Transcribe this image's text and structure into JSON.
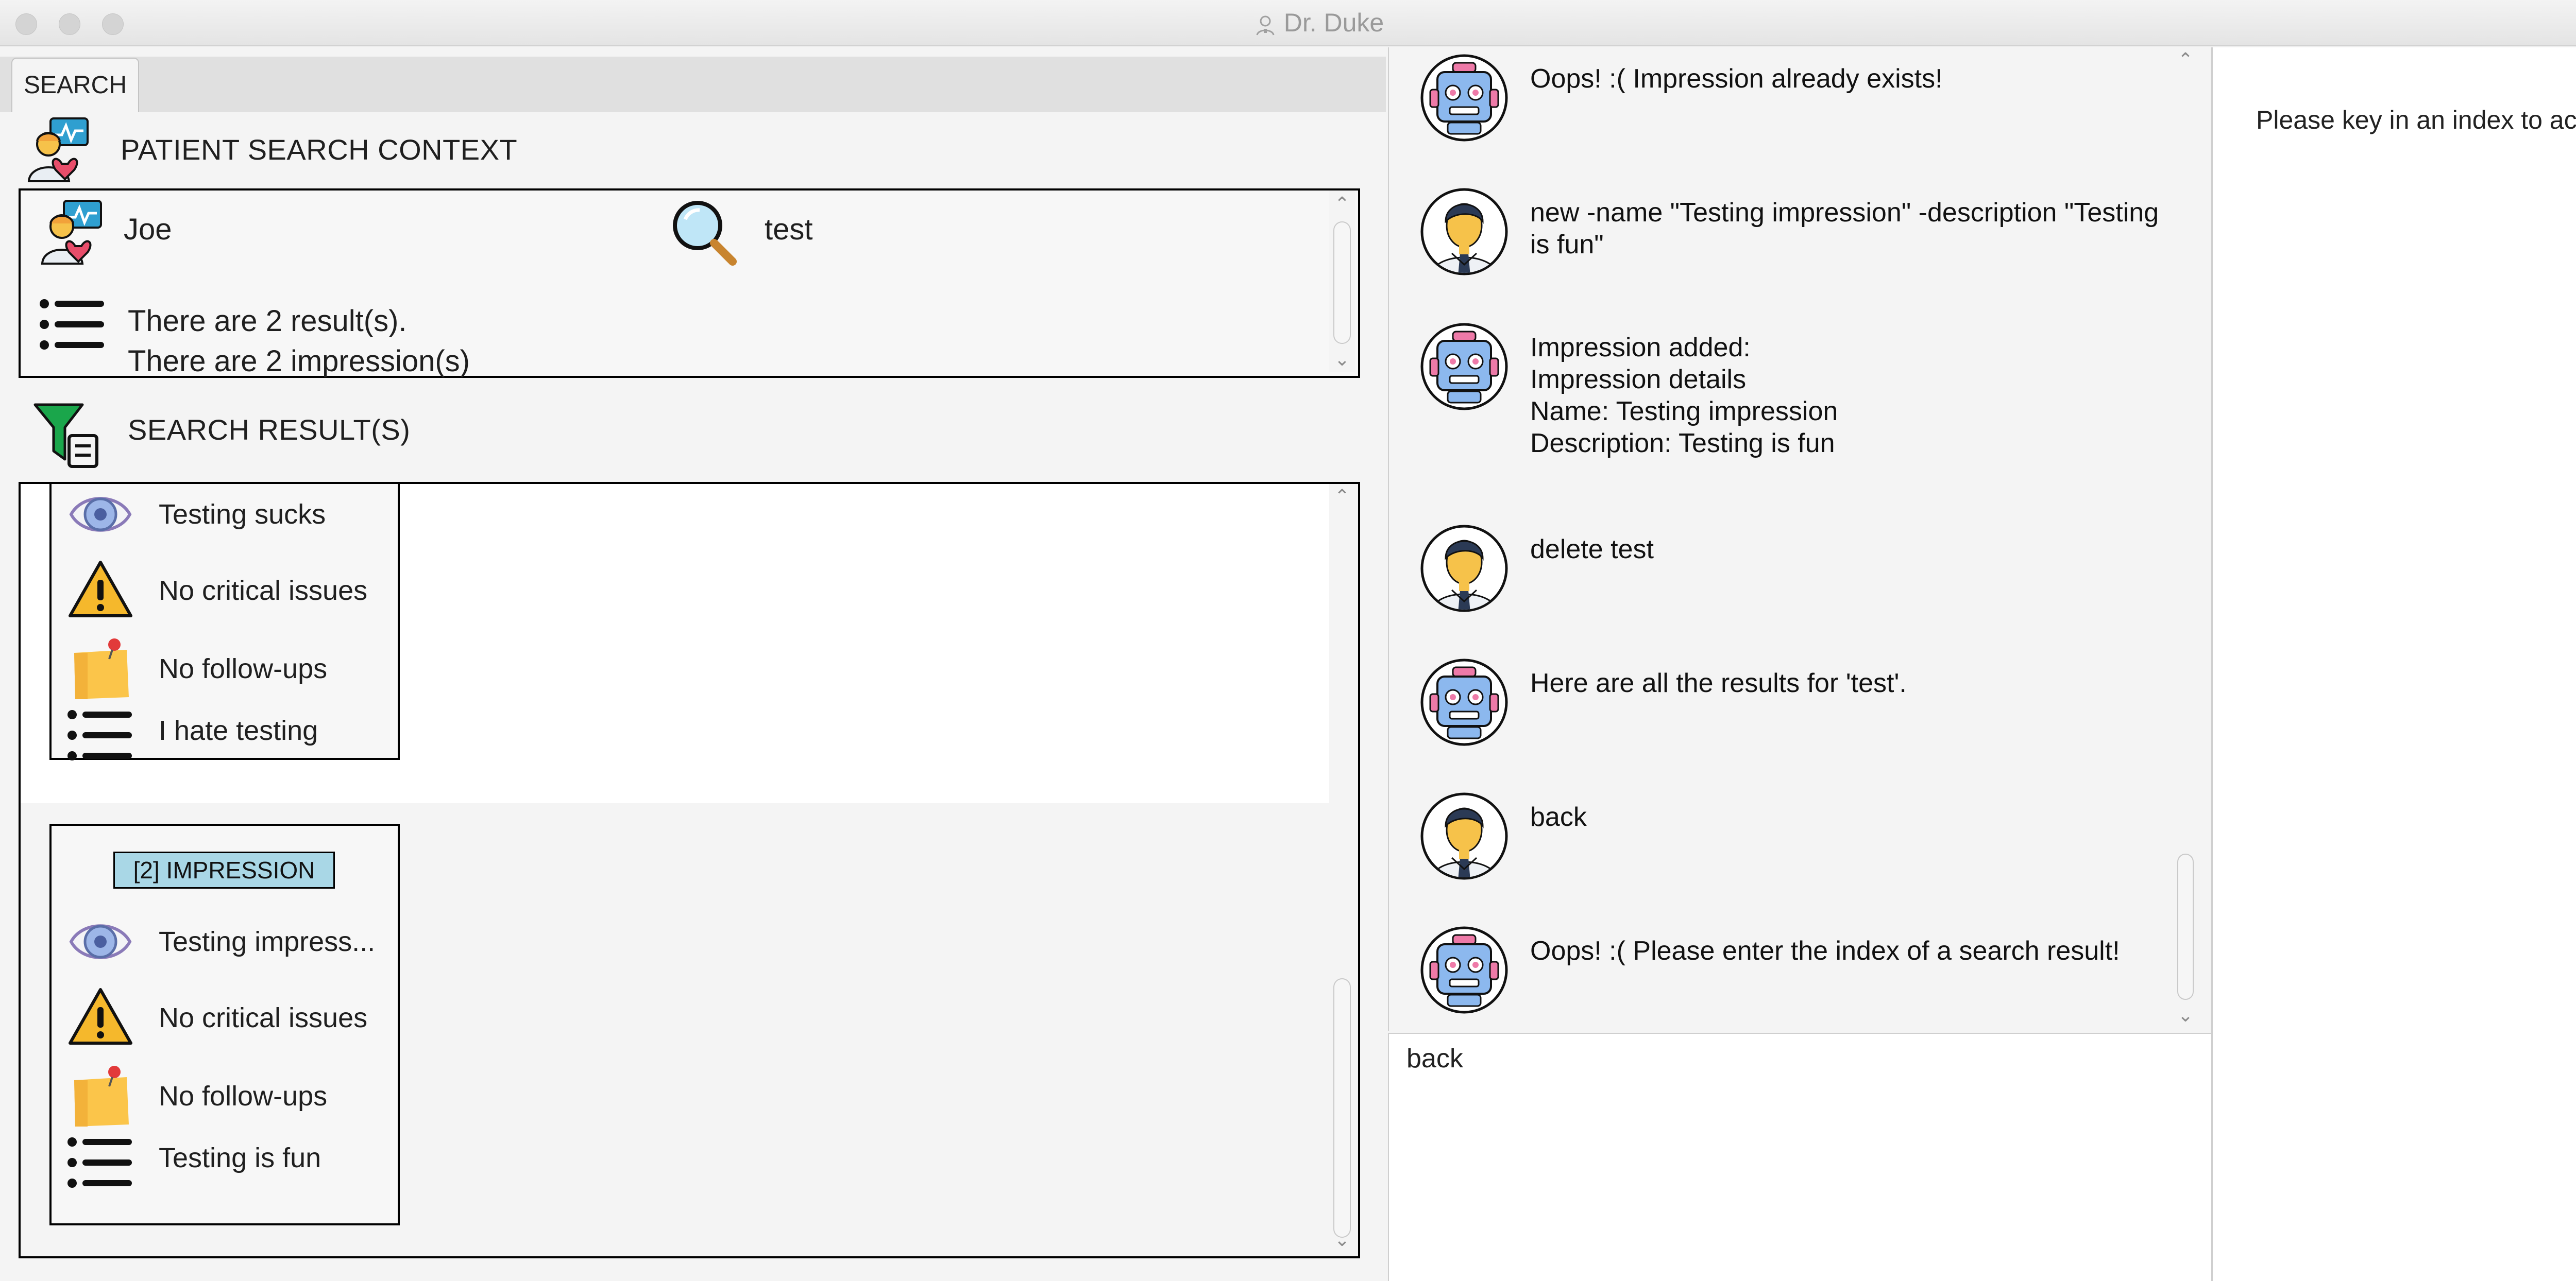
{
  "window": {
    "title": "Dr. Duke"
  },
  "tabs": [
    {
      "label": "SEARCH"
    }
  ],
  "patient_context": {
    "header": "PATIENT SEARCH CONTEXT",
    "patient_name": "Joe",
    "search_term": "test",
    "summary_line_1": "There are 2 result(s).",
    "summary_line_2": "There are 2 impression(s)"
  },
  "results": {
    "header": "SEARCH RESULT(S)",
    "cards": [
      {
        "badge": "",
        "name": "Testing sucks",
        "critical": "No critical issues",
        "followups": "No follow-ups",
        "description": "I hate testing"
      },
      {
        "badge": "[2] IMPRESSION",
        "name": "Testing impress...",
        "critical": "No critical issues",
        "followups": "No follow-ups",
        "description": "Testing is fun"
      }
    ]
  },
  "chat": {
    "messages": [
      {
        "sender": "bot",
        "text": "Oops! :( Impression already exists!"
      },
      {
        "sender": "user",
        "text": "new -name \"Testing impression\" -description \"Testing is fun\""
      },
      {
        "sender": "bot",
        "text": "Impression added:\nImpression details\nName: Testing impression\nDescription: Testing is fun"
      },
      {
        "sender": "user",
        "text": "delete test"
      },
      {
        "sender": "bot",
        "text": "Here are all the results for 'test'."
      },
      {
        "sender": "user",
        "text": "back"
      },
      {
        "sender": "bot",
        "text": "Oops! :( Please enter the index of a search result!"
      }
    ],
    "input_value": "back"
  },
  "info_panel": {
    "text": "Please key in an index to access th"
  },
  "colors": {
    "badge_bg": "#a9d7e6",
    "robot_blue": "#8cb8ee",
    "robot_pink": "#ee7aa8",
    "user_skin": "#f6c24a",
    "user_suit": "#2b3a55"
  }
}
